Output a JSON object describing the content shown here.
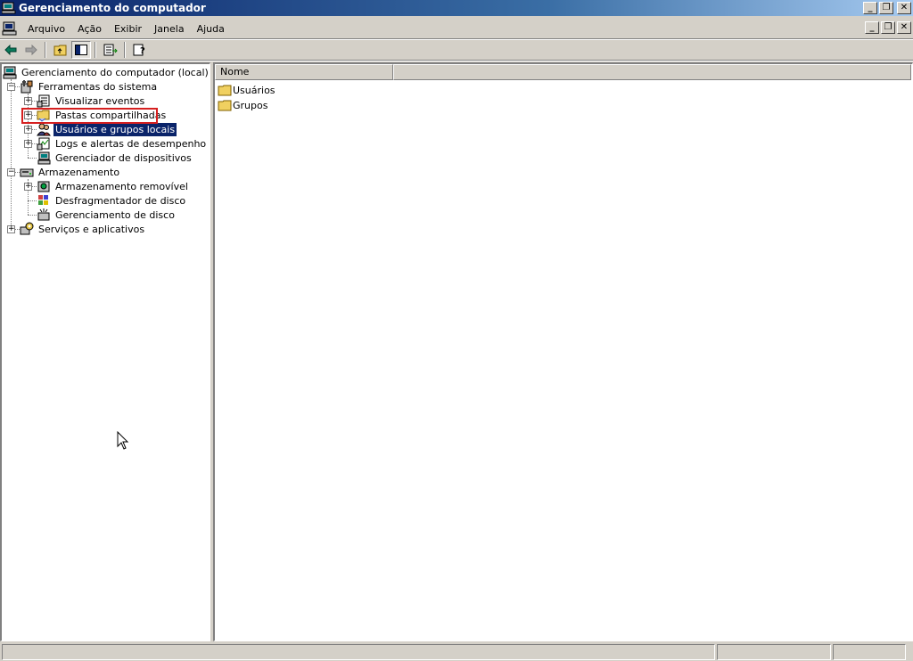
{
  "window": {
    "title": "Gerenciamento do computador"
  },
  "menu": {
    "items": [
      {
        "label": "Arquivo"
      },
      {
        "label": "Ação"
      },
      {
        "label": "Exibir"
      },
      {
        "label": "Janela"
      },
      {
        "label": "Ajuda"
      }
    ]
  },
  "tree": {
    "root": "Gerenciamento do computador (local)",
    "system_tools": "Ferramentas do sistema",
    "event_viewer": "Visualizar eventos",
    "shared_folders": "Pastas compartilhadas",
    "local_users": "Usuários e grupos locais",
    "perf_logs": "Logs e alertas de desempenho",
    "device_manager": "Gerenciador de dispositivos",
    "storage": "Armazenamento",
    "removable_storage": "Armazenamento removível",
    "defrag": "Desfragmentador de disco",
    "disk_mgmt": "Gerenciamento de disco",
    "services": "Serviços e aplicativos"
  },
  "list": {
    "column_name": "Nome",
    "items": [
      "Usuários",
      "Grupos"
    ]
  },
  "colors": {
    "title_start": "#0a246a",
    "title_end": "#a6caf0",
    "selection": "#0a246a",
    "highlight_box": "#d62020"
  }
}
